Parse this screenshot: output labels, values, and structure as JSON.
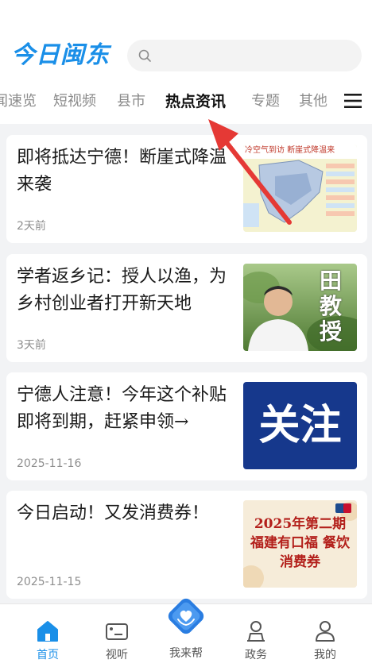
{
  "header": {
    "logo_text": "今日闽东",
    "search_placeholder": ""
  },
  "tabs": [
    {
      "label": "闻速览",
      "active": false
    },
    {
      "label": "短视频",
      "active": false
    },
    {
      "label": "县市",
      "active": false
    },
    {
      "label": "热点资讯",
      "active": true
    },
    {
      "label": "专题",
      "active": false
    },
    {
      "label": "其他",
      "active": false
    }
  ],
  "news": [
    {
      "title": "即将抵达宁德！断崖式降温来袭",
      "time": "2天前",
      "thumb": "cold-wave-weather-map",
      "thumb_text": "冷空气到访  断崖式降温来"
    },
    {
      "title": "学者返乡记：授人以渔，为乡村创业者打开新天地",
      "time": "3天前",
      "thumb": "professor-portrait",
      "thumb_text": "田教授"
    },
    {
      "title": "宁德人注意！今年这个补贴即将到期，赶紧申领→",
      "time": "2025-11-16",
      "thumb": "attention-banner",
      "thumb_text": "关注"
    },
    {
      "title": "今日启动！又发消费券！",
      "time": "2025-11-15",
      "thumb": "fujian-voucher-poster",
      "thumb_text": "2025年第二期 福建有口福 餐饮消费券"
    }
  ],
  "bottom_nav": {
    "home": "首页",
    "video": "视听",
    "help": "我来帮",
    "gov": "政务",
    "mine": "我的"
  },
  "colors": {
    "brand": "#1a8fe8",
    "arrow": "#e53935",
    "attention_bg": "#16388c"
  }
}
